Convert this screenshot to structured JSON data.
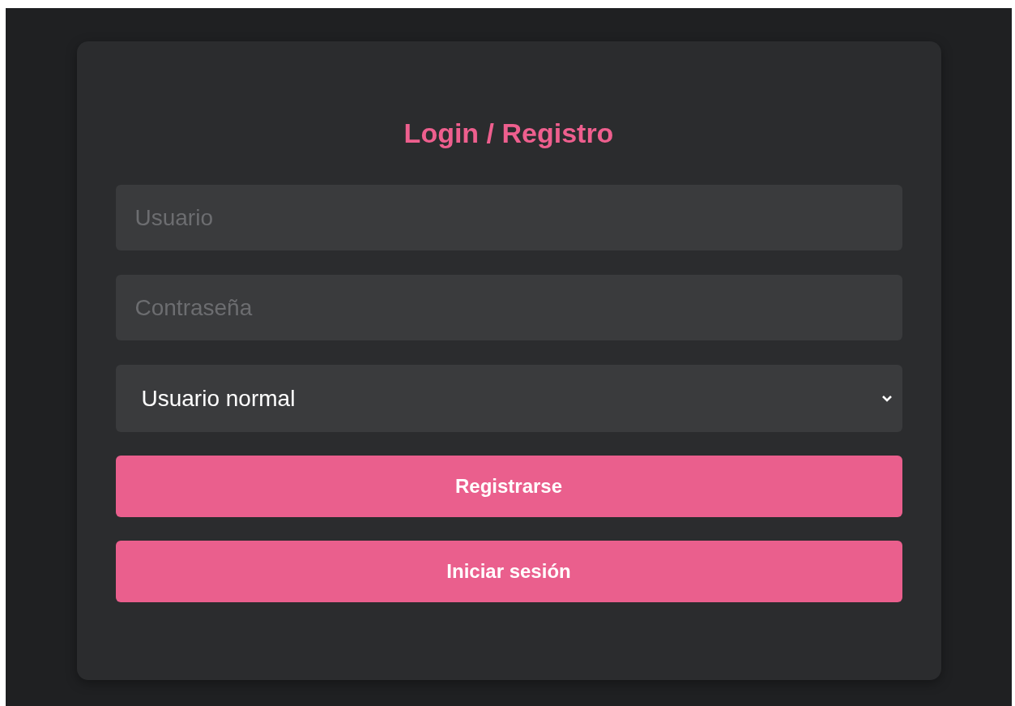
{
  "title": "Login / Registro",
  "fields": [
    {
      "placeholder": "Usuario"
    },
    {
      "placeholder": "Contraseña"
    }
  ],
  "select": {
    "value": "Usuario normal"
  },
  "buttons": [
    {
      "label": "Registrarse"
    },
    {
      "label": "Iniciar sesión"
    }
  ]
}
